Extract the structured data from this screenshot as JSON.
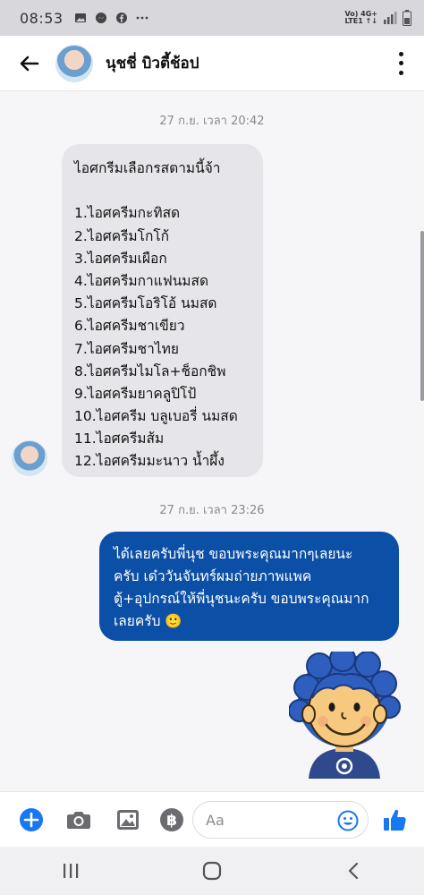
{
  "status_bar": {
    "time": "08:53",
    "network_top": "Vo) 4G+",
    "network_bottom": "LTE1 ↑↓",
    "icons": [
      "image-icon",
      "messenger-icon",
      "facebook-icon",
      "more-dots-icon",
      "signal-icon",
      "battery-icon"
    ]
  },
  "header": {
    "contact_name": "นุชชี่ บิวตี้ช้อป",
    "icons": [
      "back-arrow-icon",
      "more-vertical-icon"
    ]
  },
  "conversation": {
    "timestamp_1": "27 ก.ย. เวลา 20:42",
    "incoming_message": {
      "intro": "ไอศกรีมเลือกรสตามนี้จ้า",
      "items": [
        "1.ไอศครีมกะทิสด",
        "2.ไอศครีมโกโก้",
        "3.ไอศครีมเผือก",
        "4.ไอศครีมกาแฟนมสด",
        "5.ไอศครีมโอริโอ้ นมสด",
        "6.ไอศครีมชาเขียว",
        "7.ไอศครีมชาไทย",
        "8.ไอศครีมไมโล+ช็อกชิพ",
        "9.ไอศครีมยาคลูปิโป้",
        "10.ไอศครีม บลูเบอรี่ นมสด",
        "11.ไอศครีมส้ม",
        "12.ไอศครีมมะนาว น้ำผึ้ง"
      ]
    },
    "timestamp_2": "27 ก.ย. เวลา 23:26",
    "outgoing_message": {
      "lines": [
        "ได้เลยครับพี่นุช ขอบพระคุณมากๆเลยนะ",
        "ครับ เด๋ววันจันทร์ผมถ่ายภาพแพค",
        "ตู้+อุปกรณ์ให้พี่นุชนะครับ ขอบพระคุณมาก",
        "เลยครับ 🙂"
      ]
    }
  },
  "composer": {
    "placeholder": "Aa",
    "accent_color": "#1877f2",
    "icons": [
      "plus-icon",
      "camera-icon",
      "gallery-icon",
      "baht-payment-icon",
      "emoji-icon",
      "like-icon"
    ]
  },
  "nav_bar": {
    "icons": [
      "recents-icon",
      "home-icon",
      "back-icon"
    ]
  },
  "colors": {
    "outgoing_bubble": "#0b4fa6",
    "incoming_bubble": "#e6e6ea",
    "accent": "#1877f2"
  }
}
